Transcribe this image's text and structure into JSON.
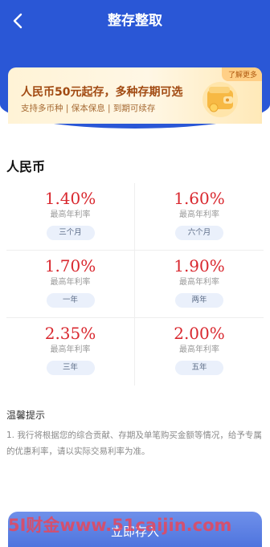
{
  "nav": {
    "title": "整存整取",
    "back_icon": "chevron-left-icon"
  },
  "promo": {
    "title": "人民币50元起存，多种存期可选",
    "subtitle": "支持多币种 | 保本保息 | 到期可续存",
    "more_label": "了解更多",
    "icon": "wallet-icon"
  },
  "section": {
    "title": "人民币"
  },
  "rates": [
    {
      "rate": "1.40%",
      "label": "最高年利率",
      "term": "三个月"
    },
    {
      "rate": "1.60%",
      "label": "最高年利率",
      "term": "六个月"
    },
    {
      "rate": "1.70%",
      "label": "最高年利率",
      "term": "一年"
    },
    {
      "rate": "1.90%",
      "label": "最高年利率",
      "term": "两年"
    },
    {
      "rate": "2.35%",
      "label": "最高年利率",
      "term": "三年"
    },
    {
      "rate": "2.00%",
      "label": "最高年利率",
      "term": "五年"
    }
  ],
  "tips": {
    "title": "温馨提示",
    "text": "1. 我行将根据您的综合贡献、存期及单笔购买金额等情况，给予专属的优惠利率，请以实际交易利率为准。"
  },
  "action": {
    "deposit_label": "立即存入"
  },
  "watermark": {
    "text": "5I财金www.51caijin.com"
  },
  "colors": {
    "brand": "#2a57d6",
    "rate": "#d9282f",
    "button": "#5a7ee3"
  }
}
